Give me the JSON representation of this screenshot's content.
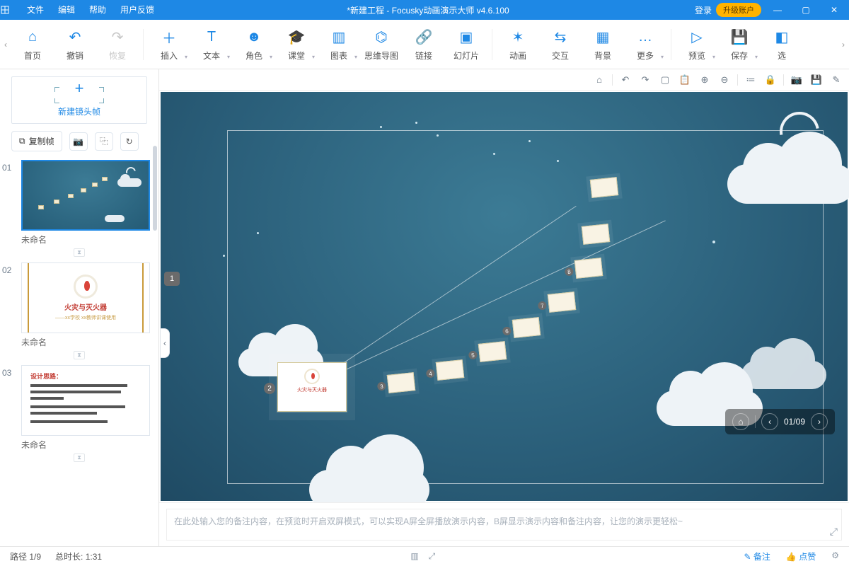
{
  "titlebar": {
    "menus": [
      "文件",
      "编辑",
      "帮助",
      "用户反馈"
    ],
    "title": "*新建工程 - Focusky动画演示大师  v4.6.100",
    "login": "登录",
    "upgrade": "升级账户"
  },
  "ribbon": {
    "items": [
      {
        "label": "首页",
        "glyph": "⌂"
      },
      {
        "label": "撤销",
        "glyph": "↶"
      },
      {
        "label": "恢复",
        "glyph": "↷",
        "off": true
      },
      {
        "sep": true
      },
      {
        "label": "插入",
        "glyph": "＋",
        "dd": true
      },
      {
        "label": "文本",
        "glyph": "T",
        "dd": true
      },
      {
        "label": "角色",
        "glyph": "☻",
        "dd": true
      },
      {
        "label": "课堂",
        "glyph": "🎓",
        "dd": true
      },
      {
        "label": "图表",
        "glyph": "▥",
        "dd": true
      },
      {
        "label": "思维导图",
        "glyph": "⌬"
      },
      {
        "label": "链接",
        "glyph": "🔗"
      },
      {
        "label": "幻灯片",
        "glyph": "▣"
      },
      {
        "sep": true
      },
      {
        "label": "动画",
        "glyph": "✶"
      },
      {
        "label": "交互",
        "glyph": "⇆"
      },
      {
        "label": "背景",
        "glyph": "▦"
      },
      {
        "label": "更多",
        "glyph": "…",
        "dd": true
      },
      {
        "sep": true
      },
      {
        "label": "预览",
        "glyph": "▷",
        "dd": true
      },
      {
        "label": "保存",
        "glyph": "💾",
        "dd": true
      },
      {
        "label": "选",
        "glyph": "◧"
      }
    ]
  },
  "newframe_label": "新建镜头帧",
  "copyframe_label": "复制帧",
  "slides": [
    {
      "num": "01",
      "cap": "未命名",
      "kind": "sky",
      "sel": true
    },
    {
      "num": "02",
      "cap": "未命名",
      "kind": "fire",
      "title": "火灾与灭火器",
      "sub": "——xx学校 xx教师讲课使用"
    },
    {
      "num": "03",
      "cap": "未命名",
      "kind": "doc",
      "heading": "设计思路："
    }
  ],
  "canvas": {
    "marker1": "1",
    "nodes": [
      {
        "l": 321,
        "t": 398,
        "n": "3"
      },
      {
        "l": 390,
        "t": 380,
        "n": "4"
      },
      {
        "l": 450,
        "t": 354,
        "n": "5"
      },
      {
        "l": 498,
        "t": 320,
        "n": "6"
      },
      {
        "l": 548,
        "t": 284,
        "n": "7"
      },
      {
        "l": 586,
        "t": 236,
        "n": "8"
      },
      {
        "l": 596,
        "t": 188
      },
      {
        "l": 608,
        "t": 122
      }
    ],
    "mainnode_num": "2"
  },
  "notes_placeholder": "在此处输入您的备注内容，在预览时开启双屏模式，可以实现A屏全屏播放演示内容，B屏显示演示内容和备注内容，让您的演示更轻松~",
  "pager": {
    "cur": "01",
    "tot": "09"
  },
  "status": {
    "path": "路径 1/9",
    "dur": "总时长: 1:31",
    "notes_btn": "备注",
    "like_btn": "点赞"
  }
}
